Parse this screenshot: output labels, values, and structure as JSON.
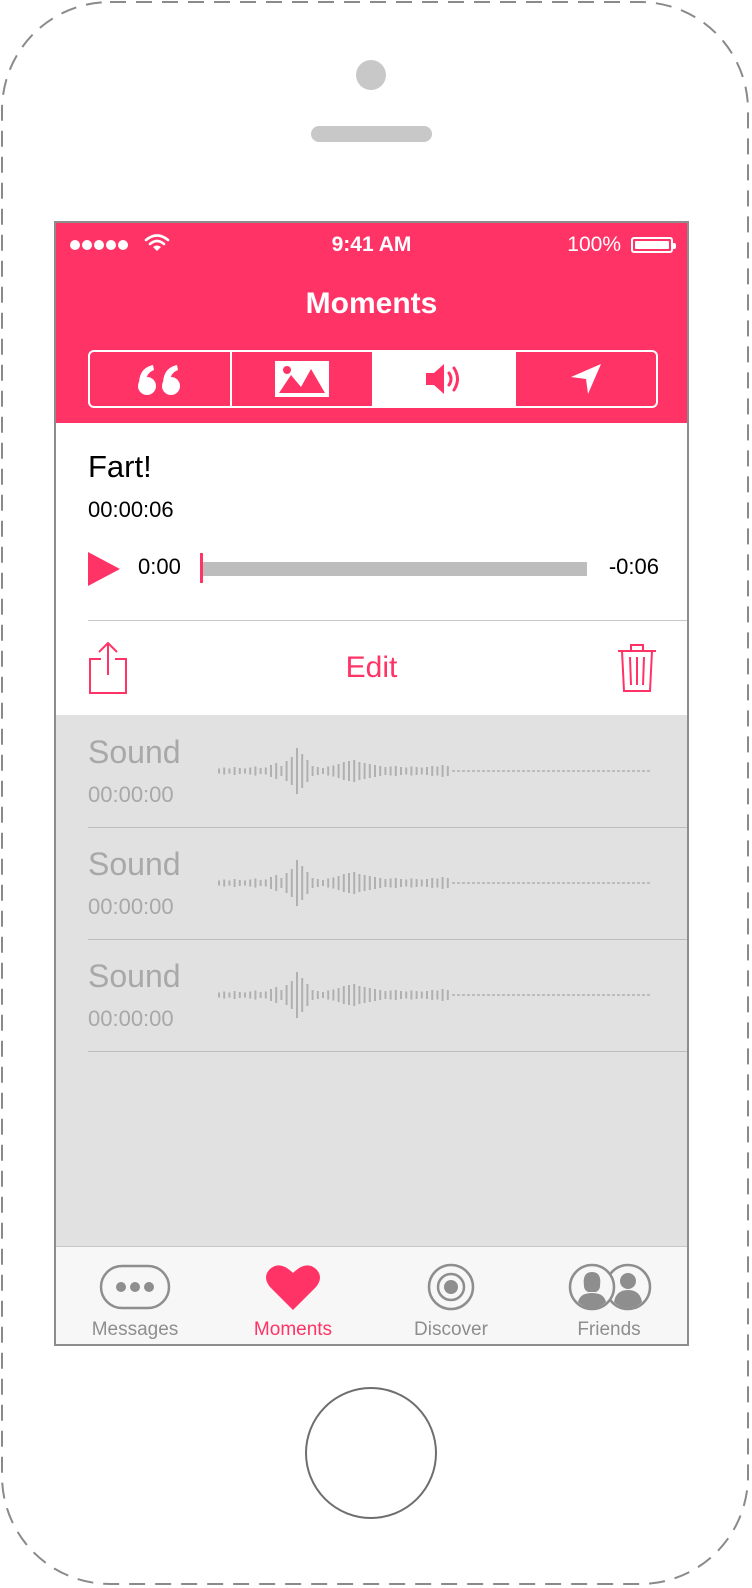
{
  "status": {
    "time": "9:41 AM",
    "battery": "100%"
  },
  "header": {
    "title": "Moments"
  },
  "segments": [
    {
      "icon": "quote-icon",
      "active": false
    },
    {
      "icon": "image-icon",
      "active": false
    },
    {
      "icon": "speaker-icon",
      "active": true
    },
    {
      "icon": "location-arrow-icon",
      "active": false
    }
  ],
  "player": {
    "title": "Fart!",
    "duration": "00:00:06",
    "current_time": "0:00",
    "remaining_time": "-0:06",
    "progress": 0.0,
    "edit_label": "Edit"
  },
  "sounds": [
    {
      "name": "Sound",
      "time": "00:00:00"
    },
    {
      "name": "Sound",
      "time": "00:00:00"
    },
    {
      "name": "Sound",
      "time": "00:00:00"
    }
  ],
  "tabbar": [
    {
      "label": "Messages",
      "icon": "chat-bubble-icon",
      "active": false
    },
    {
      "label": "Moments",
      "icon": "heart-icon",
      "active": true
    },
    {
      "label": "Discover",
      "icon": "target-icon",
      "active": false
    },
    {
      "label": "Friends",
      "icon": "friends-icon",
      "active": false
    }
  ],
  "colors": {
    "accent": "#ff3366",
    "list_bg": "#e1e1e1",
    "muted": "#a8a8a8"
  }
}
